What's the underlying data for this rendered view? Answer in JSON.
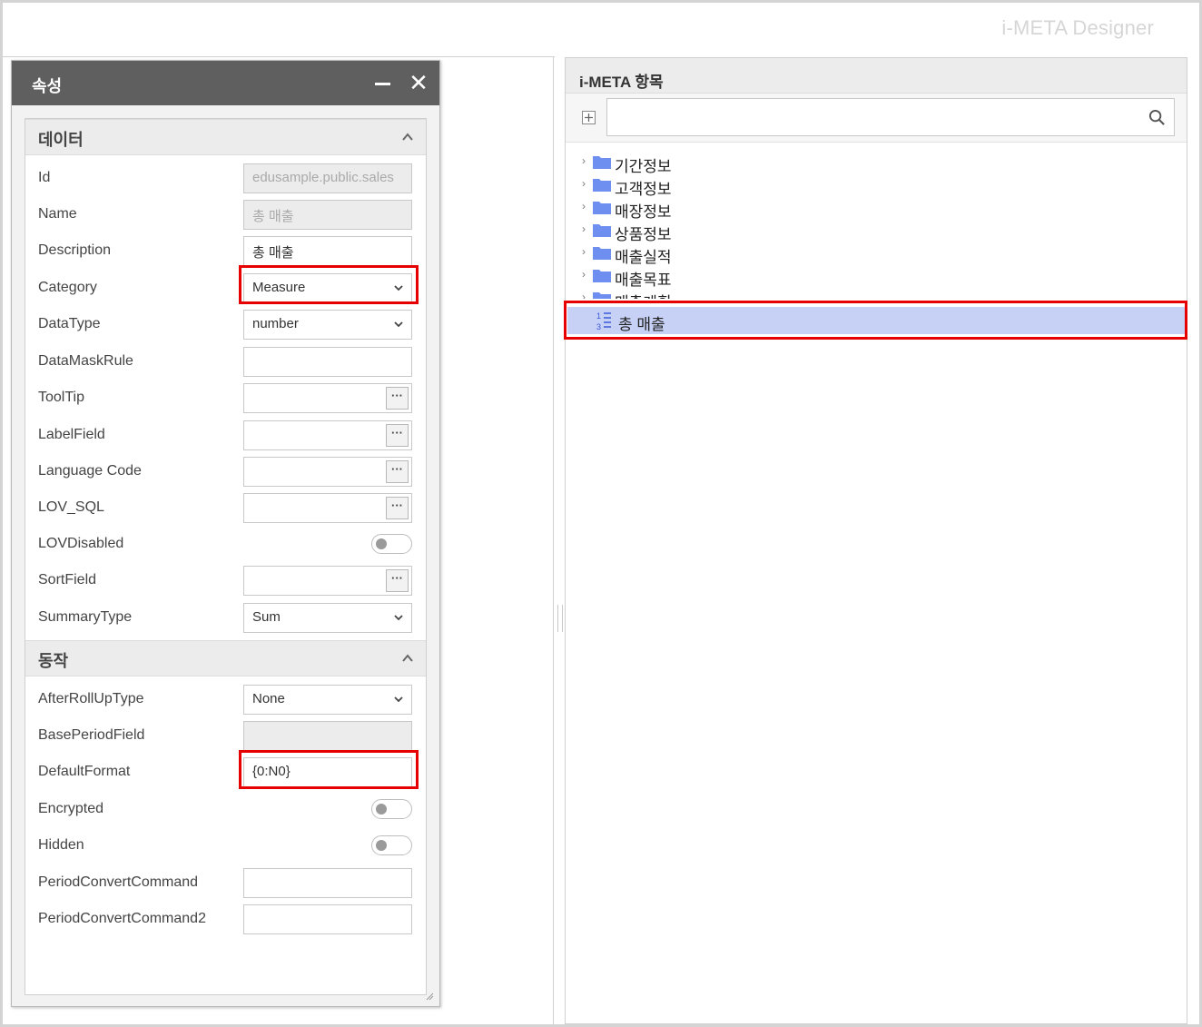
{
  "app": {
    "title": "i-META Designer"
  },
  "properties": {
    "title": "속성",
    "sections": {
      "data": {
        "title": "데이터",
        "rows": {
          "id": {
            "label": "Id",
            "value": "edusample.public.sales"
          },
          "name": {
            "label": "Name",
            "value": "총 매출"
          },
          "description": {
            "label": "Description",
            "value": "총 매출"
          },
          "category": {
            "label": "Category",
            "value": "Measure"
          },
          "datatype": {
            "label": "DataType",
            "value": "number"
          },
          "datamaskrule": {
            "label": "DataMaskRule",
            "value": ""
          },
          "tooltip": {
            "label": "ToolTip",
            "value": ""
          },
          "labelfield": {
            "label": "LabelField",
            "value": ""
          },
          "languagecode": {
            "label": "Language Code",
            "value": ""
          },
          "lovsql": {
            "label": "LOV_SQL",
            "value": ""
          },
          "lovdisabled": {
            "label": "LOVDisabled",
            "on": false
          },
          "sortfield": {
            "label": "SortField",
            "value": ""
          },
          "summarytype": {
            "label": "SummaryType",
            "value": "Sum"
          }
        }
      },
      "behavior": {
        "title": "동작",
        "rows": {
          "afterrolluptype": {
            "label": "AfterRollUpType",
            "value": "None"
          },
          "baseperiodfield": {
            "label": "BasePeriodField",
            "value": ""
          },
          "defaultformat": {
            "label": "DefaultFormat",
            "value": "{0:N0}"
          },
          "encrypted": {
            "label": "Encrypted",
            "on": false
          },
          "hidden": {
            "label": "Hidden",
            "on": false
          },
          "periodconvertcommand": {
            "label": "PeriodConvertCommand",
            "value": ""
          },
          "periodconvertcommand2": {
            "label": "PeriodConvertCommand2",
            "value": ""
          }
        }
      }
    }
  },
  "meta_panel": {
    "title": "i-META 항목",
    "search": {
      "placeholder": "",
      "value": ""
    },
    "tree": [
      {
        "label": "기간정보",
        "icon": "folder-icon"
      },
      {
        "label": "고객정보",
        "icon": "folder-icon"
      },
      {
        "label": "매장정보",
        "icon": "folder-icon"
      },
      {
        "label": "상품정보",
        "icon": "folder-icon"
      },
      {
        "label": "매출실적",
        "icon": "folder-icon"
      },
      {
        "label": "매출목표",
        "icon": "folder-icon"
      },
      {
        "label": "매출계획",
        "icon": "folder-icon"
      }
    ],
    "selected_item": {
      "label": "총 매출",
      "icon": "measure-icon"
    }
  },
  "colors": {
    "header_bg": "#5f5f5f",
    "highlight": "#e60000",
    "selection": "#c7d0f5",
    "folder": "#6f8ff0"
  }
}
